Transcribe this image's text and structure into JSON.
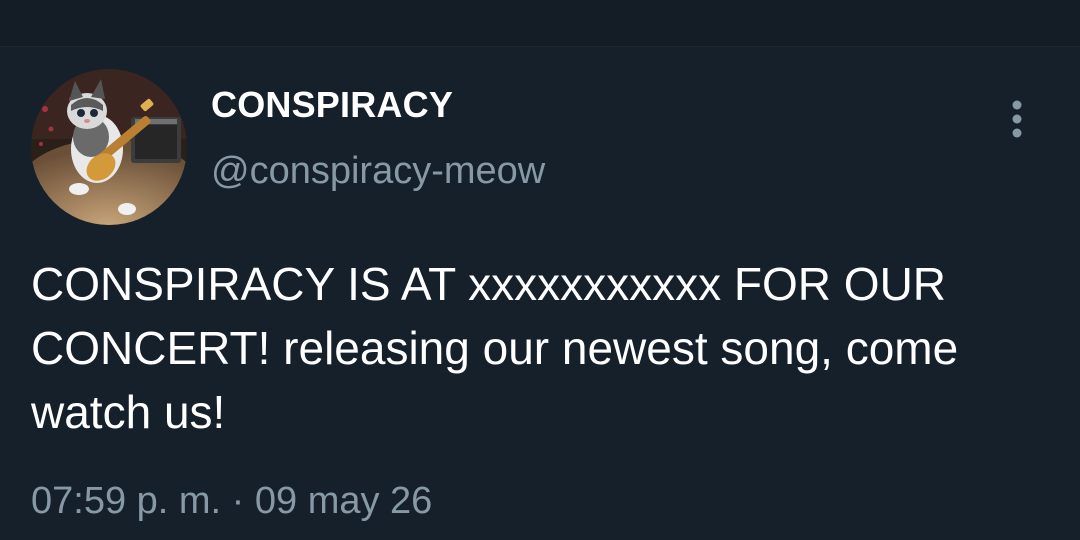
{
  "tweet": {
    "author": {
      "display_name": "CONSPIRACY",
      "handle": "@conspiracy-meow",
      "avatar": "kitten-with-guitar-avatar"
    },
    "text": "CONSPIRACY IS AT xxxxxxxxxxx FOR OUR CONCERT! releasing our newest song, come watch us!",
    "timestamp": "07:59 p. m. · 09 may 26",
    "more_icon": "more-vertical-icon"
  },
  "colors": {
    "background": "#15202b",
    "primary_text": "#ffffff",
    "secondary_text": "#8899a6"
  }
}
